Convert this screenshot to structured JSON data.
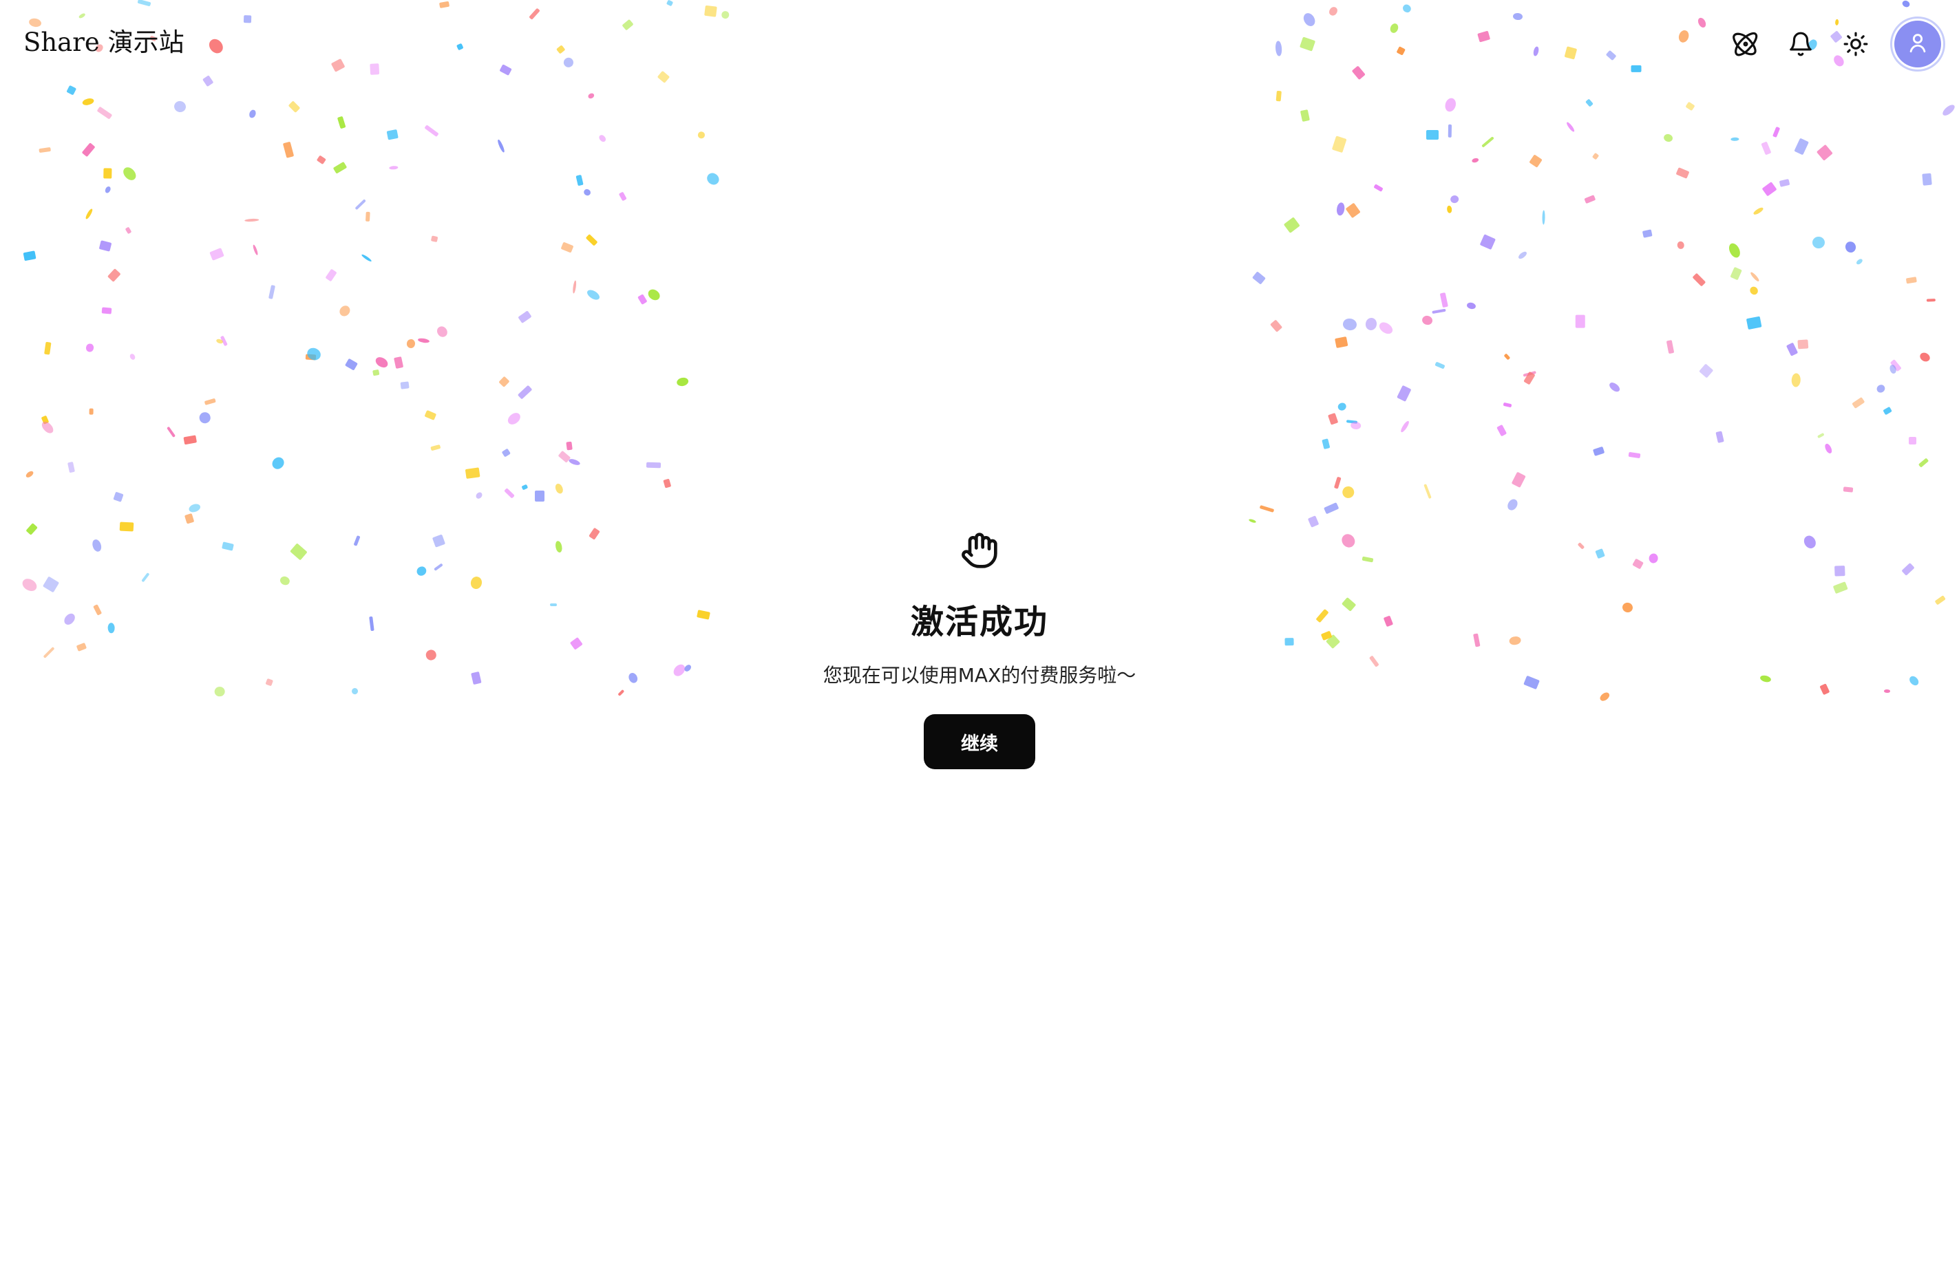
{
  "header": {
    "brand": "Share 演示站",
    "actions": [
      {
        "icon": "atom-icon",
        "label": ""
      },
      {
        "icon": "bell-icon",
        "label": ""
      },
      {
        "icon": "sun-icon",
        "label": ""
      }
    ],
    "avatar_color": "#8a8ff2"
  },
  "main": {
    "icon": "hand-wave-icon",
    "title": "激活成功",
    "subtitle": "您现在可以使用MAX的付费服务啦～",
    "continue_label": "继续"
  },
  "theme": {
    "button_bg": "#0a0a0a",
    "confetti_colors": [
      "#e879f9",
      "#f472b6",
      "#fb923c",
      "#facc15",
      "#a3e635",
      "#38bdf8",
      "#a78bfa",
      "#f87171",
      "#818cf8"
    ]
  }
}
